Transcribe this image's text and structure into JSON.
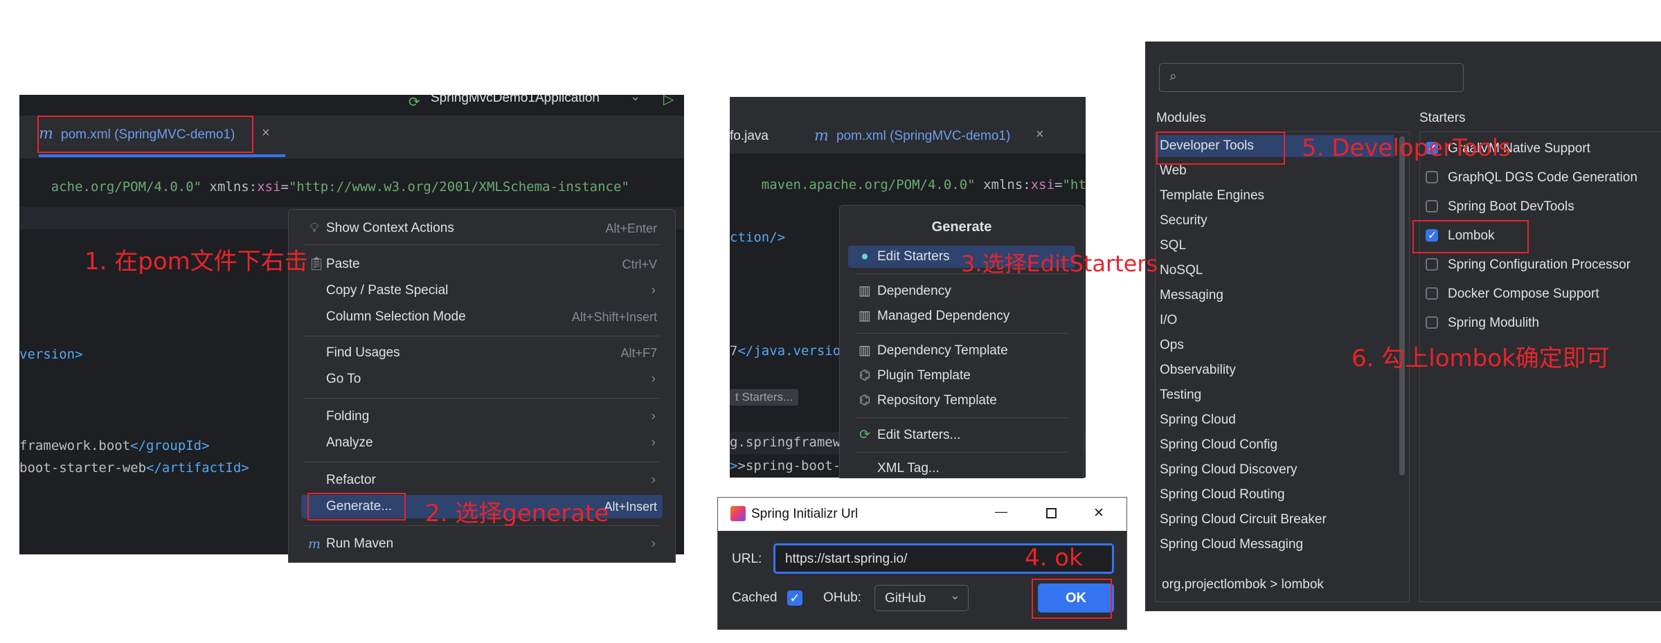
{
  "panel1": {
    "run_config": "SpringMvcDemo1Application",
    "tab_label": "pom.xml (SpringMVC-demo1)",
    "tab_close": "×",
    "code_line1_a": "ache.org/POM/4.0.0\"",
    "code_line1_b": " xmlns:",
    "code_line1_c": "xsi",
    "code_line1_d": "=",
    "code_line1_e": "\"http://www.w3.org/2001/XMLSchema-instance\"",
    "code_version": "version>",
    "code_group_a": "framework.boot",
    "code_group_b": "</groupId>",
    "code_artifact_a": "boot-starter-web",
    "code_artifact_b": "</artifactId>",
    "context_menu": [
      {
        "label": "Show Context Actions",
        "shortcut": "Alt+Enter",
        "icon": "lightbulb-icon"
      },
      {
        "label": "Paste",
        "shortcut": "Ctrl+V",
        "icon": "clipboard-icon"
      },
      {
        "label": "Copy / Paste Special",
        "shortcut": "",
        "submenu": true
      },
      {
        "label": "Column Selection Mode",
        "shortcut": "Alt+Shift+Insert"
      },
      {
        "label": "Find Usages",
        "shortcut": "Alt+F7"
      },
      {
        "label": "Go To",
        "shortcut": "",
        "submenu": true
      },
      {
        "label": "Folding",
        "shortcut": "",
        "submenu": true
      },
      {
        "label": "Analyze",
        "shortcut": "",
        "submenu": true
      },
      {
        "label": "Refactor",
        "shortcut": "",
        "submenu": true
      },
      {
        "label": "Generate...",
        "shortcut": "Alt+Insert"
      },
      {
        "label": "Run Maven",
        "shortcut": "",
        "submenu": true,
        "icon": "maven-icon"
      }
    ],
    "submenu_arrow": "›"
  },
  "panel2": {
    "tab_prev": "fo.java",
    "tab_label": "pom.xml (SpringMVC-demo1)",
    "tab_close": "×",
    "code_line1_a": "maven.apache.org/POM/4.0.0\"",
    "code_line1_b": " xmlns:",
    "code_line1_c": "xsi",
    "code_line1_d": "=",
    "code_line1_e": "\"http://www.w",
    "code_ction": "ction/>",
    "code_java_a": "7",
    "code_java_b": "</java.versio",
    "code_hint": "t Starters...",
    "code_spring_a": "g.springframew",
    "code_spring_b": ">spring-boot-s",
    "generate_title": "Generate",
    "generate_items": [
      {
        "label": "Edit Starters",
        "icon": "spring-icon"
      },
      {
        "label": "Dependency",
        "icon": "library-icon"
      },
      {
        "label": "Managed Dependency",
        "icon": "library-icon"
      },
      {
        "label": "Dependency Template",
        "icon": "library-icon"
      },
      {
        "label": "Plugin Template",
        "icon": "plugin-icon"
      },
      {
        "label": "Repository Template",
        "icon": "plugin-icon"
      },
      {
        "label": "Edit Starters...",
        "icon": "spring-icon"
      },
      {
        "label": "XML Tag...",
        "icon": ""
      }
    ]
  },
  "dialog": {
    "title": "Spring Initializr Url",
    "url_label": "URL:",
    "url_value": "https://start.spring.io/",
    "cached_label": "Cached",
    "ohub_label": "OHub:",
    "ohub_value": "GitHub",
    "ok_label": "OK",
    "minimize": "—",
    "close": "✕"
  },
  "panel3": {
    "search_placeholder": "",
    "modules_header": "Modules",
    "starters_header": "Starters",
    "modules": [
      "Developer Tools",
      "Web",
      "Template Engines",
      "Security",
      "SQL",
      "NoSQL",
      "Messaging",
      "I/O",
      "Ops",
      "Observability",
      "Testing",
      "Spring Cloud",
      "Spring Cloud Config",
      "Spring Cloud Discovery",
      "Spring Cloud Routing",
      "Spring Cloud Circuit Breaker",
      "Spring Cloud Messaging"
    ],
    "starters": [
      {
        "label": "GraalVM Native Support",
        "checked": true
      },
      {
        "label": "GraphQL DGS Code Generation",
        "checked": false
      },
      {
        "label": "Spring Boot DevTools",
        "checked": false
      },
      {
        "label": "Lombok",
        "checked": true
      },
      {
        "label": "Spring Configuration Processor",
        "checked": false
      },
      {
        "label": "Docker Compose Support",
        "checked": false
      },
      {
        "label": "Spring Modulith",
        "checked": false
      }
    ],
    "footer": "org.projectlombok > lombok"
  },
  "annotations": {
    "step1": "1. 在pom文件下右击",
    "step2": "2. 选择generate",
    "step3": "3.选择EditStarters",
    "step4": "4. ok",
    "step5": "5. DeveloperTools",
    "step6": "6. 勾上lombok确定即可"
  },
  "colors": {
    "ide_bg": "#1e1f22",
    "menu_bg": "#2b2d30",
    "selection": "#2e436e",
    "accent": "#3574f0",
    "annotation": "#e8242b"
  }
}
